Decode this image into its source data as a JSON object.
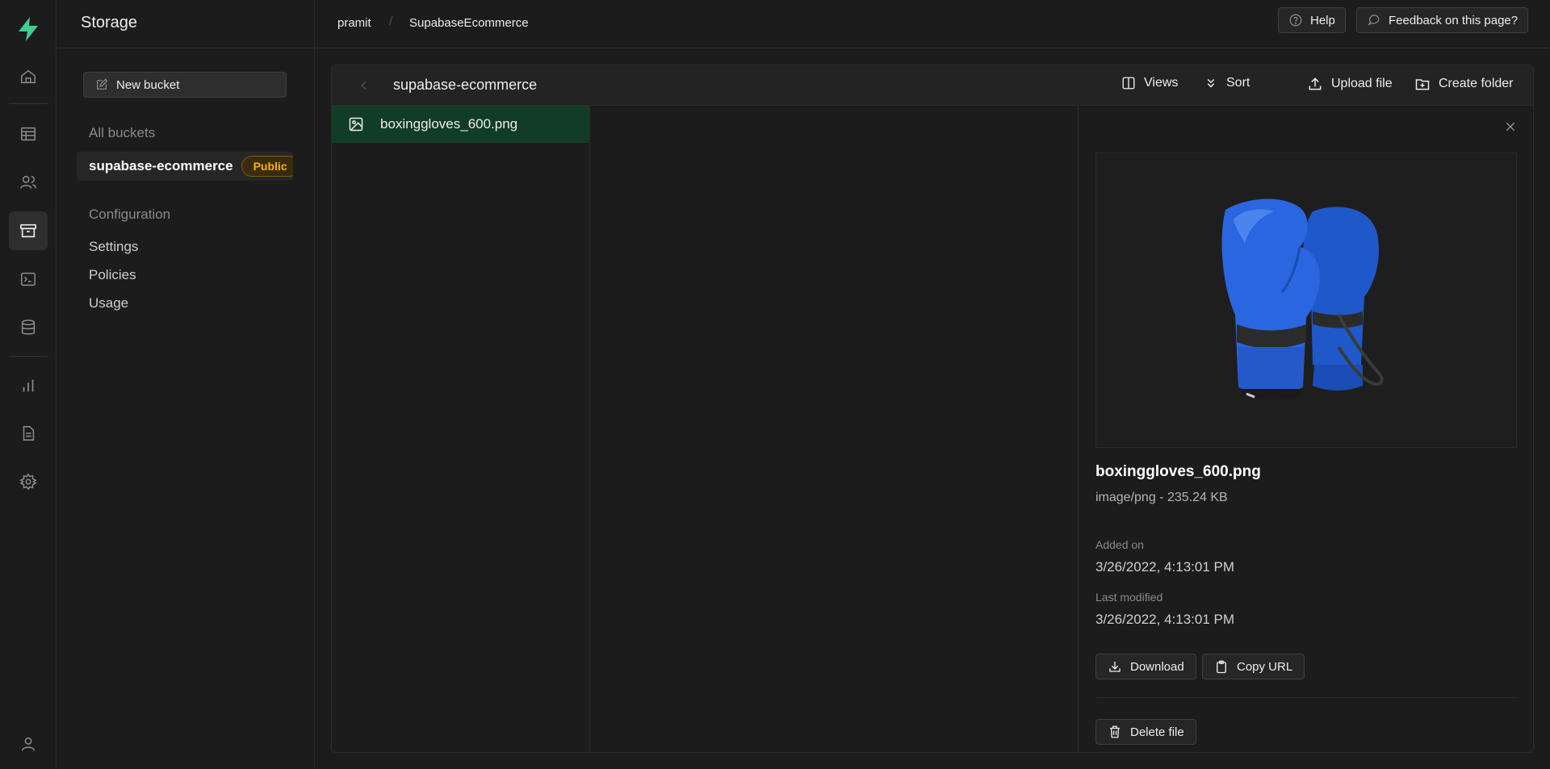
{
  "app": {
    "section_title": "Storage",
    "brand_color": "#3ecf8e",
    "nav_icons": [
      "home-icon",
      "table-editor-icon",
      "auth-users-icon",
      "storage-icon",
      "sql-editor-icon",
      "database-icon",
      "reports-icon",
      "api-docs-icon",
      "settings-icon",
      "account-icon"
    ]
  },
  "breadcrumb": {
    "org": "pramit",
    "project": "SupabaseEcommerce"
  },
  "header_buttons": {
    "help": "Help",
    "feedback": "Feedback on this page?"
  },
  "storage_menu": {
    "new_bucket_label": "New bucket",
    "all_buckets_label": "All buckets",
    "buckets": [
      {
        "name": "supabase-ecommerce",
        "badge": "Public"
      }
    ],
    "configuration_label": "Configuration",
    "links": [
      "Settings",
      "Policies",
      "Usage"
    ]
  },
  "explorer": {
    "current_bucket": "supabase-ecommerce",
    "actions": {
      "views": "Views",
      "sort": "Sort",
      "upload": "Upload file",
      "create_folder": "Create folder"
    },
    "files": [
      {
        "name": "boxinggloves_600.png",
        "icon": "image-file-icon",
        "selected": true
      }
    ]
  },
  "preview": {
    "file_name": "boxinggloves_600.png",
    "meta": "image/png - 235.24 KB",
    "added_on_label": "Added on",
    "added_on": "3/26/2022, 4:13:01 PM",
    "last_modified_label": "Last modified",
    "last_modified": "3/26/2022, 4:13:01 PM",
    "download_label": "Download",
    "copy_url_label": "Copy URL",
    "delete_label": "Delete file"
  }
}
